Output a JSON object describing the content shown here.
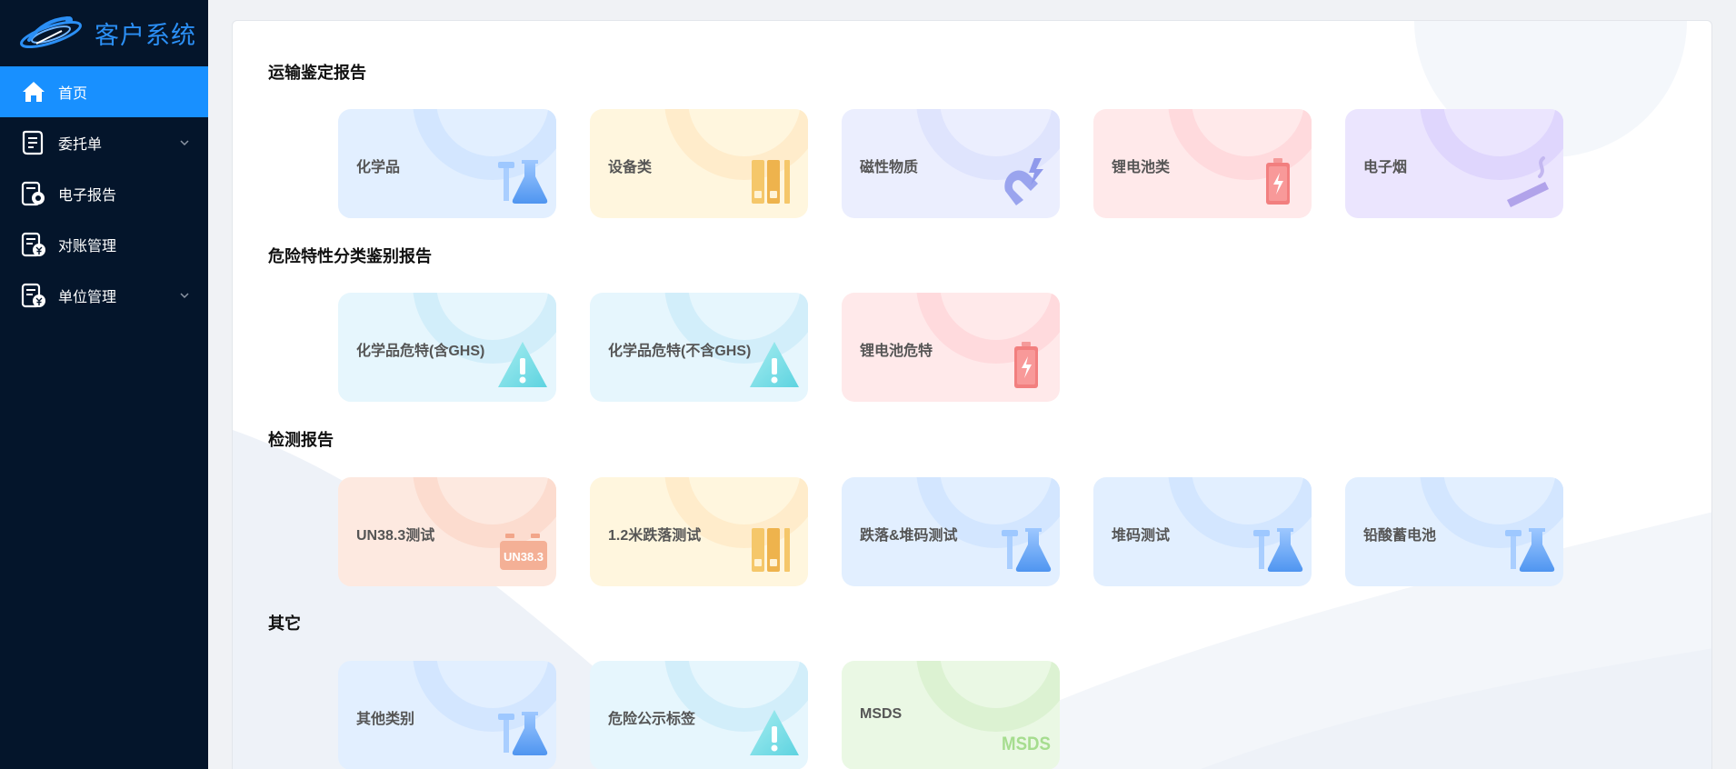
{
  "app": {
    "title": "客户系统"
  },
  "sidebar": {
    "items": [
      {
        "label": "首页",
        "icon": "home-icon",
        "active": true
      },
      {
        "label": "委托单",
        "icon": "order-icon",
        "expandable": true
      },
      {
        "label": "电子报告",
        "icon": "report-view-icon"
      },
      {
        "label": "对账管理",
        "icon": "bill-icon"
      },
      {
        "label": "单位管理",
        "icon": "company-icon",
        "expandable": true
      }
    ]
  },
  "colors": {
    "sidebar_bg": "#04152b",
    "accent": "#1890ff",
    "logo_text": "#2b8ff5"
  },
  "sections": [
    {
      "title": "运输鉴定报告",
      "cards": [
        {
          "label": "化学品",
          "icon": "flask-icon",
          "theme": "blue"
        },
        {
          "label": "设备类",
          "icon": "binders-icon",
          "theme": "yellow"
        },
        {
          "label": "磁性物质",
          "icon": "magnet-icon",
          "theme": "indigo"
        },
        {
          "label": "锂电池类",
          "icon": "battery-icon",
          "theme": "pink"
        },
        {
          "label": "电子烟",
          "icon": "cigarette-icon",
          "theme": "purple"
        }
      ]
    },
    {
      "title": "危险特性分类鉴别报告",
      "cards": [
        {
          "label": "化学品危特(含GHS)",
          "icon": "warning-icon",
          "theme": "cyan"
        },
        {
          "label": "化学品危特(不含GHS)",
          "icon": "warning-icon",
          "theme": "cyan"
        },
        {
          "label": "锂电池危特",
          "icon": "battery-icon",
          "theme": "pink"
        }
      ]
    },
    {
      "title": "检测报告",
      "cards": [
        {
          "label": "UN38.3测试",
          "icon": "un383-battery-icon",
          "theme": "peach",
          "icon_text": "UN38.3"
        },
        {
          "label": "1.2米跌落测试",
          "icon": "binders-icon",
          "theme": "yellow"
        },
        {
          "label": "跌落&堆码测试",
          "icon": "flask-icon",
          "theme": "blue"
        },
        {
          "label": "堆码测试",
          "icon": "flask-icon",
          "theme": "blue"
        },
        {
          "label": "铅酸蓄电池",
          "icon": "flask-icon",
          "theme": "blue"
        }
      ]
    },
    {
      "title": "其它",
      "cards": [
        {
          "label": "其他类别",
          "icon": "flask-icon",
          "theme": "blue"
        },
        {
          "label": "危险公示标签",
          "icon": "warning-icon",
          "theme": "cyan"
        },
        {
          "label": "MSDS",
          "icon": "msds-icon",
          "theme": "green",
          "icon_text": "MSDS"
        }
      ]
    }
  ]
}
